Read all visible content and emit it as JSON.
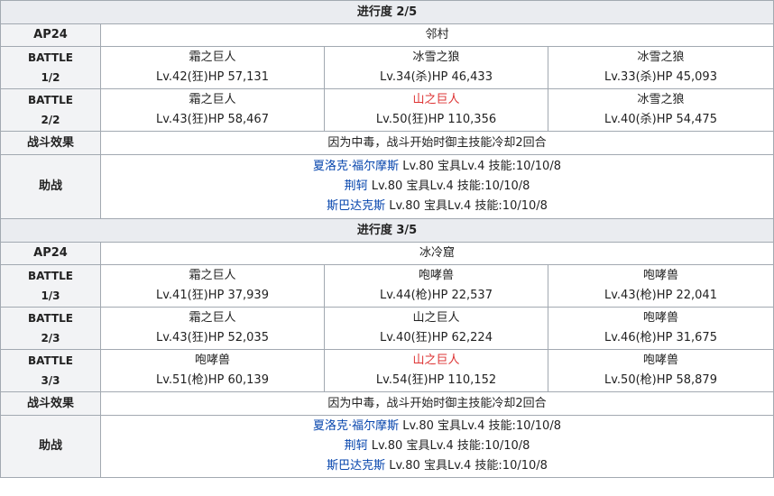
{
  "sections": [
    {
      "title": "进行度 2/5",
      "ap": "AP24",
      "location": "邻村",
      "battles": [
        {
          "label_top": "BATTLE",
          "label_bottom": "1/2",
          "enemies": [
            {
              "name": "霜之巨人",
              "stats": "Lv.42(狂)HP 57,131",
              "highlight": false
            },
            {
              "name": "冰雪之狼",
              "stats": "Lv.34(杀)HP 46,433",
              "highlight": false
            },
            {
              "name": "冰雪之狼",
              "stats": "Lv.33(杀)HP 45,093",
              "highlight": false
            }
          ]
        },
        {
          "label_top": "BATTLE",
          "label_bottom": "2/2",
          "enemies": [
            {
              "name": "霜之巨人",
              "stats": "Lv.43(狂)HP 58,467",
              "highlight": false
            },
            {
              "name": "山之巨人",
              "stats": "Lv.50(狂)HP 110,356",
              "highlight": true
            },
            {
              "name": "冰雪之狼",
              "stats": "Lv.40(杀)HP 54,475",
              "highlight": false
            }
          ]
        }
      ],
      "effect_label": "战斗效果",
      "effect_text": "因为中毒，战斗开始时御主技能冷却2回合",
      "support_label": "助战",
      "supports": [
        {
          "name": "夏洛克·福尔摩斯",
          "details": " Lv.80 宝具Lv.4 技能:10/10/8"
        },
        {
          "name": "荆轲",
          "details": " Lv.80 宝具Lv.4 技能:10/10/8"
        },
        {
          "name": "斯巴达克斯",
          "details": " Lv.80 宝具Lv.4 技能:10/10/8"
        }
      ]
    },
    {
      "title": "进行度 3/5",
      "ap": "AP24",
      "location": "冰冷窟",
      "battles": [
        {
          "label_top": "BATTLE",
          "label_bottom": "1/3",
          "enemies": [
            {
              "name": "霜之巨人",
              "stats": "Lv.41(狂)HP 37,939",
              "highlight": false
            },
            {
              "name": "咆哮兽",
              "stats": "Lv.44(枪)HP 22,537",
              "highlight": false
            },
            {
              "name": "咆哮兽",
              "stats": "Lv.43(枪)HP 22,041",
              "highlight": false
            }
          ]
        },
        {
          "label_top": "BATTLE",
          "label_bottom": "2/3",
          "enemies": [
            {
              "name": "霜之巨人",
              "stats": "Lv.43(狂)HP 52,035",
              "highlight": false
            },
            {
              "name": "山之巨人",
              "stats": "Lv.40(狂)HP 62,224",
              "highlight": false
            },
            {
              "name": "咆哮兽",
              "stats": "Lv.46(枪)HP 31,675",
              "highlight": false
            }
          ]
        },
        {
          "label_top": "BATTLE",
          "label_bottom": "3/3",
          "enemies": [
            {
              "name": "咆哮兽",
              "stats": "Lv.51(枪)HP 60,139",
              "highlight": false
            },
            {
              "name": "山之巨人",
              "stats": "Lv.54(狂)HP 110,152",
              "highlight": true
            },
            {
              "name": "咆哮兽",
              "stats": "Lv.50(枪)HP 58,879",
              "highlight": false
            }
          ]
        }
      ],
      "effect_label": "战斗效果",
      "effect_text": "因为中毒，战斗开始时御主技能冷却2回合",
      "support_label": "助战",
      "supports": [
        {
          "name": "夏洛克·福尔摩斯",
          "details": " Lv.80 宝具Lv.4 技能:10/10/8"
        },
        {
          "name": "荆轲",
          "details": " Lv.80 宝具Lv.4 技能:10/10/8"
        },
        {
          "name": "斯巴达克斯",
          "details": " Lv.80 宝具Lv.4 技能:10/10/8"
        }
      ]
    }
  ]
}
